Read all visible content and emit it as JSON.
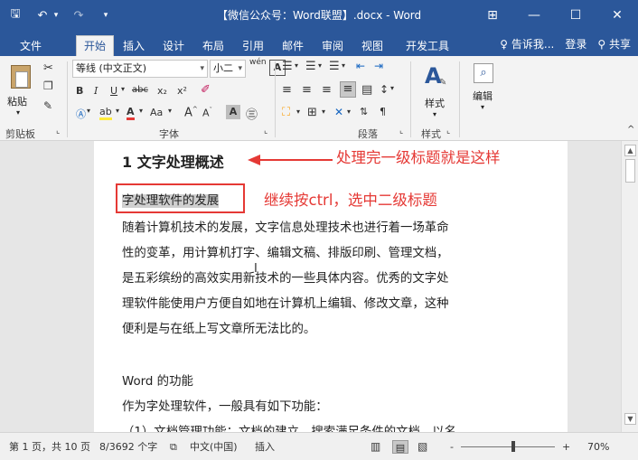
{
  "window": {
    "title": "【微信公众号：Word联盟】.docx - Word",
    "controls": {
      "options": "⊞",
      "minimize": "—",
      "maximize": "☐",
      "close": "✕"
    }
  },
  "qat": {
    "save": "🖫",
    "undo": "↶",
    "undo_drop": "▾",
    "redo": "↷",
    "customize": "▾"
  },
  "tabs": [
    "文件",
    "开始",
    "插入",
    "设计",
    "布局",
    "引用",
    "邮件",
    "审阅",
    "视图",
    "开发工具"
  ],
  "tabs_right": {
    "tell_me": "告诉我...",
    "login": "登录",
    "share": "共享"
  },
  "ribbon": {
    "clipboard": {
      "paste": "粘贴",
      "label": "剪贴板"
    },
    "font": {
      "family": "等线 (中文正文)",
      "size": "小二",
      "bold": "B",
      "italic": "I",
      "underline": "U",
      "strike": "abc",
      "sub": "x₂",
      "sup": "x²",
      "clear": "A",
      "highlight": "ab",
      "font_color": "A",
      "case": "Aa",
      "grow": "A",
      "shrink": "A",
      "char_shade": "A",
      "enclose": "㊂",
      "phonetic": "wén",
      "label": "字体"
    },
    "paragraph": {
      "label": "段落"
    },
    "styles": {
      "button": "样式",
      "label": "样式"
    },
    "editing": {
      "button": "编辑"
    }
  },
  "document": {
    "heading1": "1 文字处理概述",
    "heading2": "字处理软件的发展",
    "paragraph1": [
      "随着计算机技术的发展，文字信息处理技术也进行着一场革命",
      "性的变革，用计算机打字、编辑文稿、排版印刷、管理文档，",
      "是五彩缤纷的高效实用新技术的一些具体内容。优秀的文字处",
      "理软件能使用户方便自如地在计算机上编辑、修改文章，这种",
      "便利是与在纸上写文章所无法比的。"
    ],
    "word_func_title": "Word 的功能",
    "word_func_intro": "作为字处理软件，一般具有如下功能：",
    "cut_line": "（1）文档管理功能：文档的建立、搜索满足条件的文档、以名"
  },
  "annotations": {
    "a1": "处理完一级标题就是这样",
    "a2": "继续按ctrl，选中二级标题"
  },
  "status": {
    "page": "第 1 页，共 10 页",
    "words": "8/3692 个字",
    "lang": "中文(中国)",
    "insert": "插入",
    "zoom": "70%",
    "zoom_minus": "-",
    "zoom_plus": "+"
  },
  "colors": {
    "brand": "#2b579a",
    "annotation": "#e53935"
  }
}
